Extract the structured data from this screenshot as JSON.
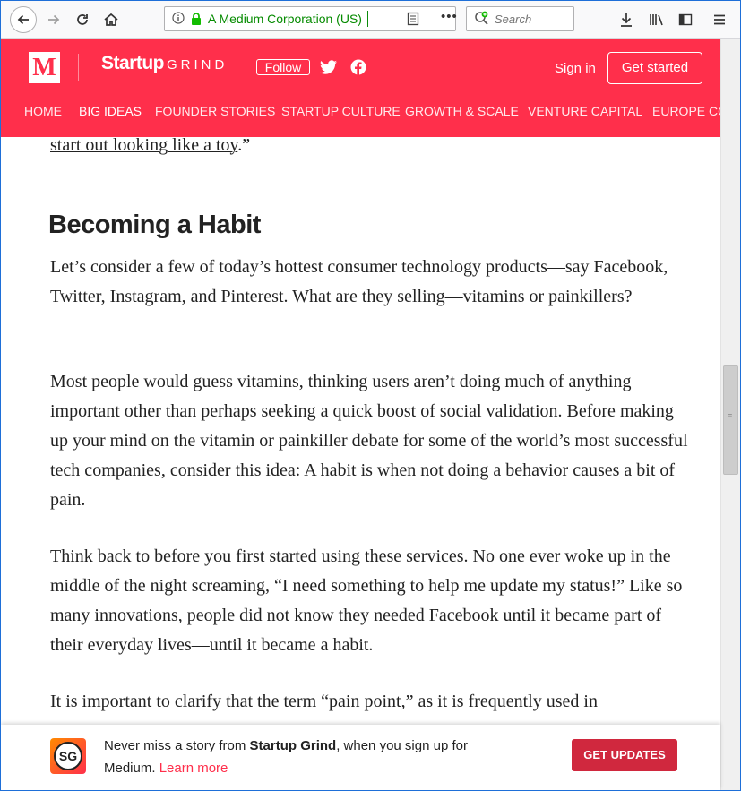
{
  "browser": {
    "identity": "A Medium Corporation (US)",
    "search_placeholder": "Search"
  },
  "header": {
    "logo": "M",
    "brand_a": "Startup",
    "brand_b": "GRIND",
    "follow": "Follow",
    "signin": "Sign in",
    "get_started": "Get started",
    "nav": [
      "HOME",
      "BIG IDEAS",
      "FOUNDER STORIES",
      "STARTUP CULTURE",
      "GROWTH & SCALE",
      "VENTURE CAPITAL",
      "EUROPE CO"
    ]
  },
  "article": {
    "lead_link": "start out looking like a toy",
    "lead_tail": ".”",
    "heading": "Becoming a Habit",
    "p1": "Let’s consider a few of today’s hottest consumer technology products—say Facebook, Twitter, Instagram, and Pinterest. What are they selling—vitamins or painkillers?",
    "p2": "Most people would guess vitamins, thinking users aren’t doing much of anything important other than perhaps seeking a quick boost of social validation. Before making up your mind on the vitamin or painkiller debate for some of the world’s most successful tech companies, consider this idea: A habit is when not doing a behavior causes a bit of pain.",
    "p3": "Think back to before you first started using these services. No one ever woke up in the middle of the night screaming, “I need something to help me update my status!” Like so many innovations, people did not know they needed Facebook until it became part of their everyday lives—until it became a habit.",
    "p4": "It is important to clarify that the term “pain point,” as it is frequently used in"
  },
  "banner": {
    "logo": "SG",
    "text_a": "Never miss a story from ",
    "text_b": "Startup Grind",
    "text_c": ", when you sign up for Medium. ",
    "learn_more": "Learn more",
    "button": "GET UPDATES"
  }
}
